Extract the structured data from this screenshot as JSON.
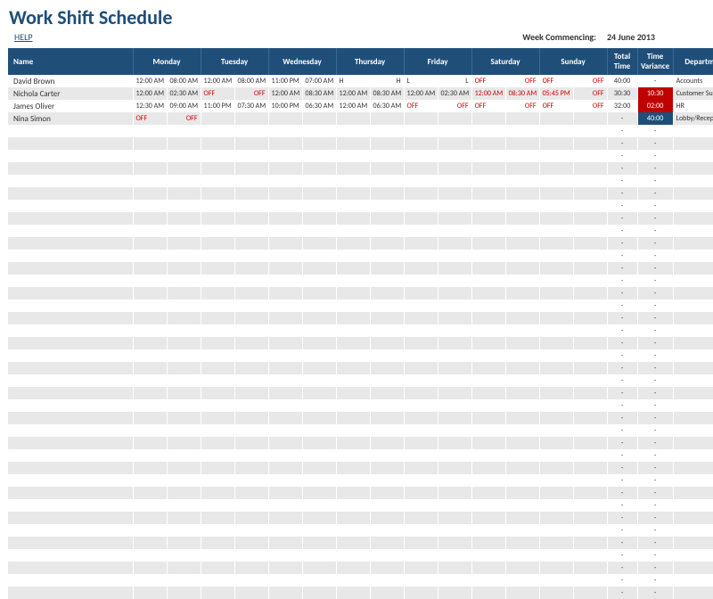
{
  "title": "Work Shift Schedule",
  "help": "HELP",
  "week_label": "Week Commencing:",
  "week_date": "24 June 2013",
  "headers": {
    "name": "Name",
    "days": [
      "Monday",
      "Tuesday",
      "Wednesday",
      "Thursday",
      "Friday",
      "Saturday",
      "Sunday"
    ],
    "total": "Total Time",
    "variance": "Time Variance",
    "dept": "Department"
  },
  "rows": [
    {
      "name": "David Brown",
      "cells": [
        [
          "12:00 AM",
          "08:00 AM"
        ],
        [
          "12:00 AM",
          "08:00 AM"
        ],
        [
          "11:00 PM",
          "07:00 AM"
        ],
        [
          "H",
          "H"
        ],
        [
          "L",
          "L"
        ],
        [
          "OFF",
          "OFF"
        ],
        [
          "OFF",
          "OFF"
        ]
      ],
      "off_flags": [
        [
          0,
          0
        ],
        [
          0,
          0
        ],
        [
          0,
          0
        ],
        [
          0,
          0
        ],
        [
          0,
          0
        ],
        [
          1,
          1
        ],
        [
          1,
          1
        ]
      ],
      "total": "40:00",
      "variance": "-",
      "var_cls": "",
      "dept": "Accounts"
    },
    {
      "name": "Nichola Carter",
      "cells": [
        [
          "12:00 AM",
          "02:30 AM"
        ],
        [
          "OFF",
          "OFF"
        ],
        [
          "12:00 AM",
          "08:30 AM"
        ],
        [
          "12:00 AM",
          "08:30 AM"
        ],
        [
          "12:00 AM",
          "02:30 AM"
        ],
        [
          "12:00 AM",
          "08:30 AM"
        ],
        [
          "05:45 PM",
          "OFF"
        ]
      ],
      "off_flags": [
        [
          0,
          0
        ],
        [
          1,
          1
        ],
        [
          0,
          0
        ],
        [
          0,
          0
        ],
        [
          0,
          0
        ],
        [
          1,
          1
        ],
        [
          1,
          1
        ]
      ],
      "total": "30:30",
      "variance": "10:30",
      "var_cls": "var-bad",
      "dept": "Customer Support"
    },
    {
      "name": "James Oliver",
      "cells": [
        [
          "12:30 AM",
          "09:00 AM"
        ],
        [
          "11:00 PM",
          "07:30 AM"
        ],
        [
          "10:00 PM",
          "06:30 AM"
        ],
        [
          "12:00 AM",
          "06:30 AM"
        ],
        [
          "OFF",
          "OFF"
        ],
        [
          "OFF",
          "OFF"
        ],
        [
          "OFF",
          "OFF"
        ]
      ],
      "off_flags": [
        [
          0,
          0
        ],
        [
          0,
          0
        ],
        [
          0,
          0
        ],
        [
          0,
          0
        ],
        [
          1,
          1
        ],
        [
          1,
          1
        ],
        [
          1,
          1
        ]
      ],
      "total": "32:00",
      "variance": "02:00",
      "var_cls": "var-bad",
      "dept": "HR"
    },
    {
      "name": "Nina Simon",
      "cells": [
        [
          "OFF",
          "OFF"
        ],
        [
          "",
          ""
        ],
        [
          "",
          ""
        ],
        [
          "",
          ""
        ],
        [
          "",
          ""
        ],
        [
          "",
          ""
        ],
        [
          "",
          ""
        ]
      ],
      "off_flags": [
        [
          1,
          1
        ],
        [
          0,
          0
        ],
        [
          0,
          0
        ],
        [
          0,
          0
        ],
        [
          0,
          0
        ],
        [
          0,
          0
        ],
        [
          0,
          0
        ]
      ],
      "total": "-",
      "variance": "40:00",
      "var_cls": "var-dark",
      "dept": "Lobby/Reception"
    }
  ],
  "empty_rows": 38,
  "empty_placeholder": "-"
}
